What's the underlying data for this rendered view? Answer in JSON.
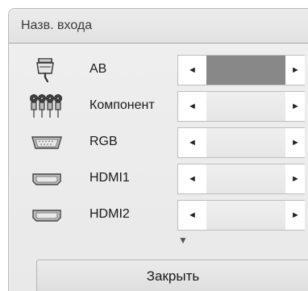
{
  "header": {
    "title": "Назв. входа"
  },
  "inputs": [
    {
      "label": "AB",
      "icon": "scart-icon",
      "active": true
    },
    {
      "label": "Компонент",
      "icon": "component-rca-icon",
      "active": false
    },
    {
      "label": "RGB",
      "icon": "vga-icon",
      "active": false
    },
    {
      "label": "HDMI1",
      "icon": "hdmi-icon",
      "active": false
    },
    {
      "label": "HDMI2",
      "icon": "hdmi-icon",
      "active": false
    }
  ],
  "arrows": {
    "left": "◄",
    "right": "►",
    "down": "▼"
  },
  "footer": {
    "close_label": "Закрыть"
  }
}
